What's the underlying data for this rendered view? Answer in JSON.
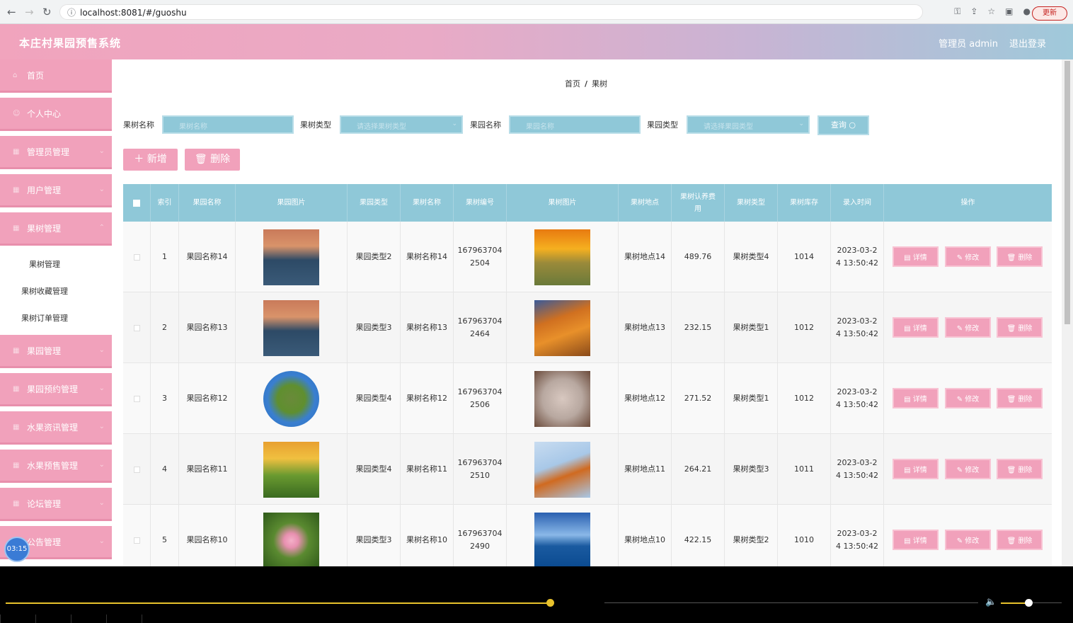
{
  "browser": {
    "url": "localhost:8081/#/guoshu",
    "update_label": "更新"
  },
  "header": {
    "title": "本庄村果园预售系统",
    "user": "管理员 admin",
    "logout": "退出登录"
  },
  "sidebar": {
    "items": [
      {
        "label": "首页"
      },
      {
        "label": "个人中心"
      },
      {
        "label": "管理员管理"
      },
      {
        "label": "用户管理"
      },
      {
        "label": "果树管理"
      }
    ],
    "subitems": [
      {
        "label": "果树管理"
      },
      {
        "label": "果树收藏管理"
      },
      {
        "label": "果树订单管理"
      }
    ],
    "items2": [
      {
        "label": "果园管理"
      },
      {
        "label": "果园预约管理"
      },
      {
        "label": "水果资讯管理"
      },
      {
        "label": "水果预售管理"
      },
      {
        "label": "论坛管理"
      },
      {
        "label": "公告管理"
      }
    ]
  },
  "breadcrumb": {
    "home": "首页",
    "sep": "/",
    "current": "果树"
  },
  "filters": {
    "f1_label": "果树名称",
    "f1_placeholder": "果树名称",
    "f2_label": "果树类型",
    "f2_placeholder": "请选择果树类型",
    "f3_label": "果园名称",
    "f3_placeholder": "果园名称",
    "f4_label": "果园类型",
    "f4_placeholder": "请选择果园类型",
    "query": "查询 ○"
  },
  "actions": {
    "add": "＋ 新增",
    "delete": "🗑 删除"
  },
  "table": {
    "headers": {
      "index": "索引",
      "yuanname": "果园名称",
      "yuanimg": "果园图片",
      "yuantype": "果园类型",
      "shuname": "果树名称",
      "shuno": "果树编号",
      "shuimg": "果树图片",
      "place": "果树地点",
      "fee": "果树认养费用",
      "shutype": "果树类型",
      "stock": "果树库存",
      "time": "录入时间",
      "ops": "操作"
    },
    "btn_detail": "详情",
    "btn_edit": "修改",
    "btn_del": "删除",
    "rows": [
      {
        "index": "1",
        "yuanname": "果园名称14",
        "yuantype": "果园类型2",
        "shuname": "果树名称14",
        "no1": "167963704",
        "no2": "2504",
        "place": "果树地点14",
        "fee": "489.76",
        "shutype": "果树类型4",
        "stock": "1014",
        "t1": "2023-03-2",
        "t2": "4 13:50:42"
      },
      {
        "index": "2",
        "yuanname": "果园名称13",
        "yuantype": "果园类型3",
        "shuname": "果树名称13",
        "no1": "167963704",
        "no2": "2464",
        "place": "果树地点13",
        "fee": "232.15",
        "shutype": "果树类型1",
        "stock": "1012",
        "t1": "2023-03-2",
        "t2": "4 13:50:42"
      },
      {
        "index": "3",
        "yuanname": "果园名称12",
        "yuantype": "果园类型4",
        "shuname": "果树名称12",
        "no1": "167963704",
        "no2": "2506",
        "place": "果树地点12",
        "fee": "271.52",
        "shutype": "果树类型1",
        "stock": "1012",
        "t1": "2023-03-2",
        "t2": "4 13:50:42"
      },
      {
        "index": "4",
        "yuanname": "果园名称11",
        "yuantype": "果园类型4",
        "shuname": "果树名称11",
        "no1": "167963704",
        "no2": "2510",
        "place": "果树地点11",
        "fee": "264.21",
        "shutype": "果树类型3",
        "stock": "1011",
        "t1": "2023-03-2",
        "t2": "4 13:50:42"
      },
      {
        "index": "5",
        "yuanname": "果园名称10",
        "yuantype": "果园类型3",
        "shuname": "果树名称10",
        "no1": "167963704",
        "no2": "2490",
        "place": "果树地点10",
        "fee": "422.15",
        "shutype": "果树类型2",
        "stock": "1010",
        "t1": "2023-03-2",
        "t2": "4 13:50:42"
      }
    ]
  },
  "player": {
    "timer": "03:15",
    "progress": 0.56,
    "volume": 0.45
  },
  "colors": {
    "accent": "#f1a1bb",
    "table_head": "#8fc8d8"
  }
}
